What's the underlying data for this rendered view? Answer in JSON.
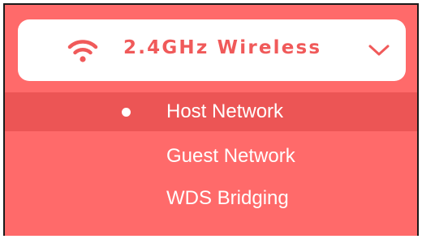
{
  "header": {
    "title": "2.4GHz Wireless",
    "icon": "wifi-icon",
    "toggle_icon": "chevron-down-icon"
  },
  "menu": {
    "items": [
      {
        "label": "Host Network",
        "selected": true
      },
      {
        "label": "Guest Network",
        "selected": false
      },
      {
        "label": "WDS Bridging",
        "selected": false
      }
    ]
  },
  "colors": {
    "panel_bg": "#ff6a6a",
    "selected_bg": "#ec5555",
    "accent": "#f05a5a",
    "text_light": "#ffffff"
  }
}
